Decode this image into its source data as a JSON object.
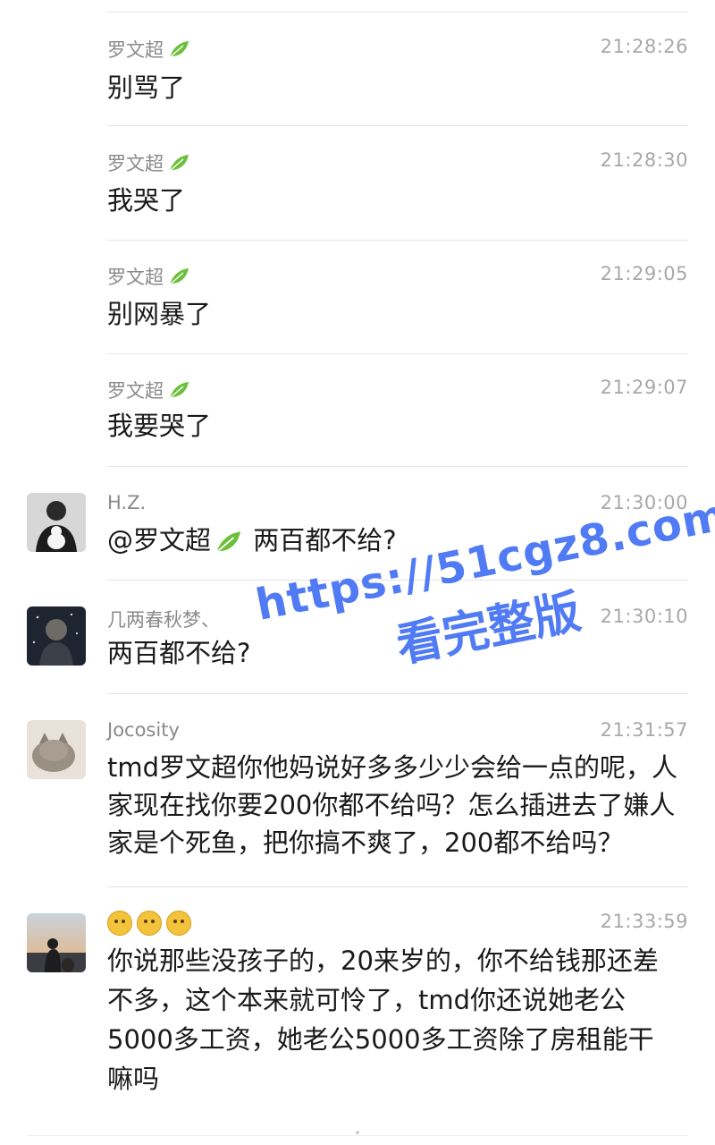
{
  "messages": [
    {
      "sender": "罗文超",
      "time": "21:28:26",
      "text": "别骂了"
    },
    {
      "sender": "罗文超",
      "time": "21:28:30",
      "text": "我哭了"
    },
    {
      "sender": "罗文超",
      "time": "21:29:05",
      "text": "别网暴了"
    },
    {
      "sender": "罗文超",
      "time": "21:29:07",
      "text": "我要哭了"
    },
    {
      "sender": "H.Z.",
      "time": "21:30:00",
      "mention": "@罗文超",
      "text": " 两百都不给?"
    },
    {
      "sender": "几两春秋梦、",
      "time": "21:30:10",
      "text": "两百都不给?"
    },
    {
      "sender": "Jocosity",
      "time": "21:31:57",
      "text": "tmd罗文超你他妈说好多多少少会给一点的呢，人家现在找你要200你都不给吗？怎么插进去了嫌人家是个死鱼，把你搞不爽了，200都不给吗？"
    },
    {
      "sender": "",
      "time": "21:33:59",
      "text": "你说那些没孩子的，20来岁的，你不给钱那还差不多，这个本来就可怜了，tmd你还说她老公5000多工资，她老公5000多工资除了房租能干嘛吗"
    }
  ],
  "watermark": {
    "line1": "https://51cgz8.com",
    "line2": "看完整版"
  },
  "colors": {
    "accent": "#3f6df3",
    "leaf": "#6bbf3a"
  }
}
